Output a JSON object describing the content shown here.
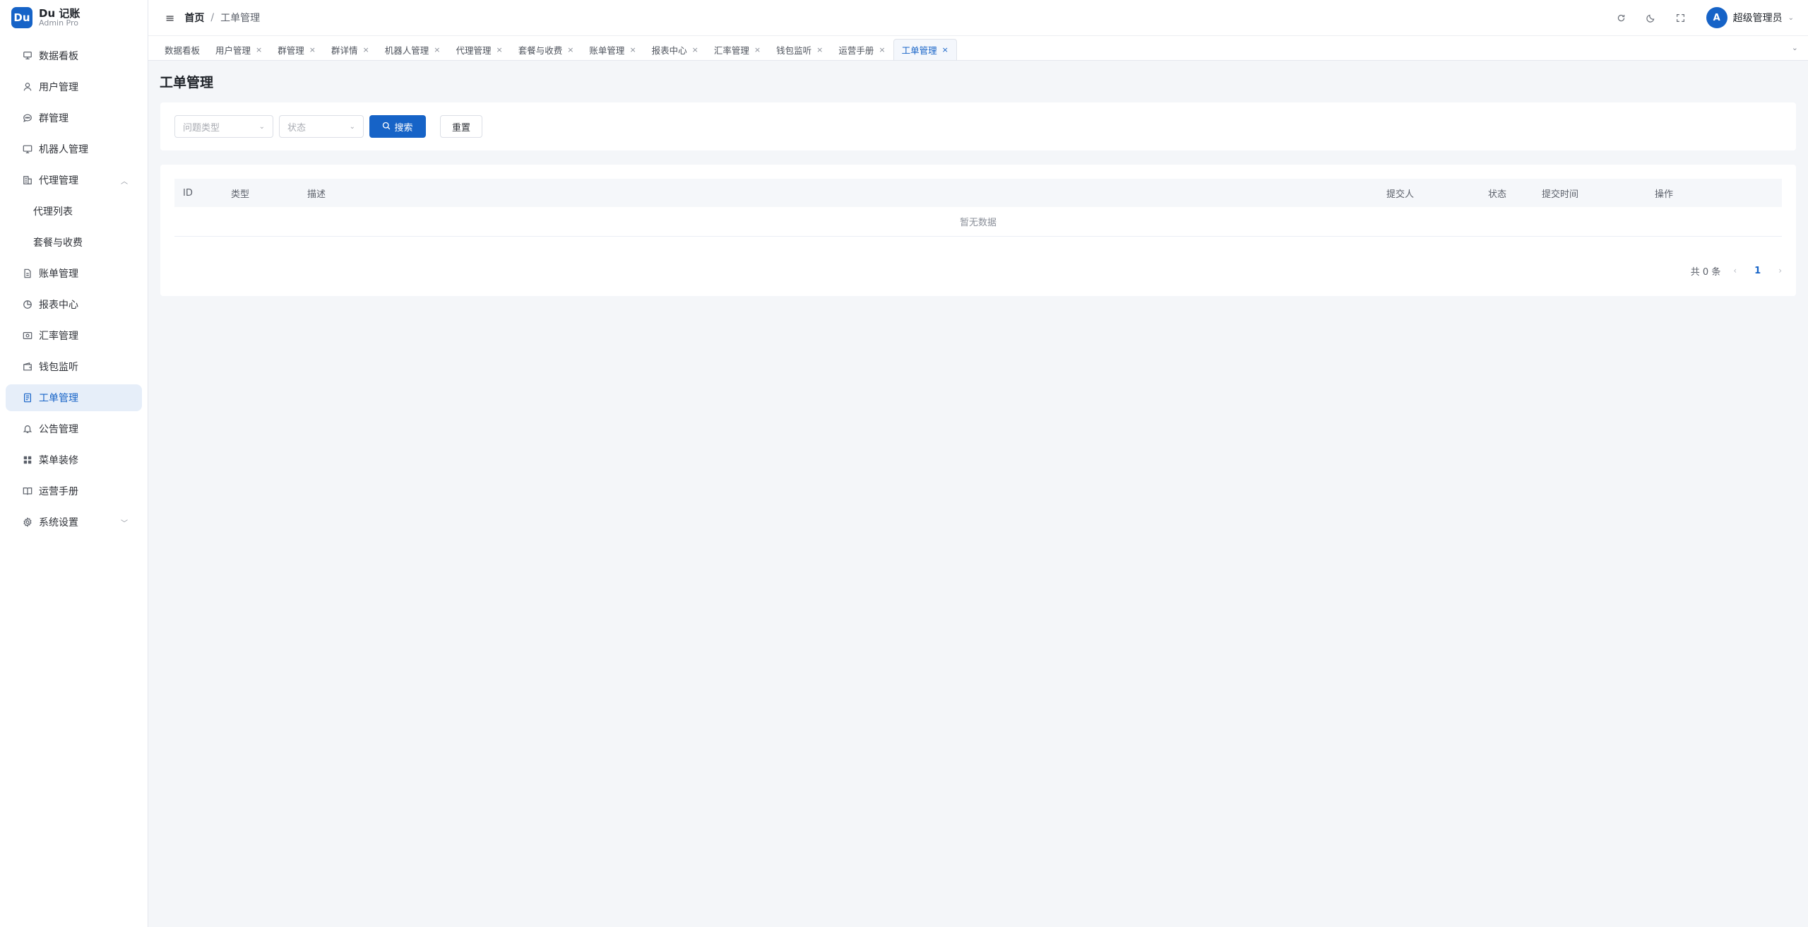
{
  "brand": {
    "logo": "Du",
    "title": "Du 记账",
    "subtitle": "Admin Pro"
  },
  "sidebar": {
    "items": [
      {
        "label": "数据看板",
        "icon": "dashboard-icon"
      },
      {
        "label": "用户管理",
        "icon": "user-icon"
      },
      {
        "label": "群管理",
        "icon": "chat-icon"
      },
      {
        "label": "机器人管理",
        "icon": "monitor-icon"
      },
      {
        "label": "代理管理",
        "icon": "building-icon",
        "expanded": true
      },
      {
        "label": "代理列表",
        "sub": true
      },
      {
        "label": "套餐与收费",
        "sub": true
      },
      {
        "label": "账单管理",
        "icon": "document-icon"
      },
      {
        "label": "报表中心",
        "icon": "pie-chart-icon"
      },
      {
        "label": "汇率管理",
        "icon": "exchange-icon"
      },
      {
        "label": "钱包监听",
        "icon": "wallet-icon"
      },
      {
        "label": "工单管理",
        "icon": "ticket-icon",
        "active": true
      },
      {
        "label": "公告管理",
        "icon": "bell-icon"
      },
      {
        "label": "菜单装修",
        "icon": "grid-icon"
      },
      {
        "label": "运营手册",
        "icon": "book-icon"
      },
      {
        "label": "系统设置",
        "icon": "gear-icon",
        "collapsed": true
      }
    ]
  },
  "header": {
    "breadcrumb_home": "首页",
    "breadcrumb_sep": "/",
    "breadcrumb_current": "工单管理",
    "user_avatar": "A",
    "user_name": "超级管理员"
  },
  "tabs": [
    {
      "label": "数据看板",
      "closable": false
    },
    {
      "label": "用户管理",
      "closable": true
    },
    {
      "label": "群管理",
      "closable": true
    },
    {
      "label": "群详情",
      "closable": true
    },
    {
      "label": "机器人管理",
      "closable": true
    },
    {
      "label": "代理管理",
      "closable": true
    },
    {
      "label": "套餐与收费",
      "closable": true
    },
    {
      "label": "账单管理",
      "closable": true
    },
    {
      "label": "报表中心",
      "closable": true
    },
    {
      "label": "汇率管理",
      "closable": true
    },
    {
      "label": "钱包监听",
      "closable": true
    },
    {
      "label": "运营手册",
      "closable": true
    },
    {
      "label": "工单管理",
      "closable": true,
      "active": true
    }
  ],
  "page": {
    "title": "工单管理",
    "filters": {
      "type_placeholder": "问题类型",
      "status_placeholder": "状态",
      "search_label": "搜索",
      "reset_label": "重置"
    },
    "table": {
      "columns": [
        "ID",
        "类型",
        "描述",
        "提交人",
        "状态",
        "提交时间",
        "操作"
      ],
      "rows": [],
      "empty_text": "暂无数据"
    },
    "pagination": {
      "total_text": "共 0 条",
      "current_page": "1",
      "prev": "‹",
      "next": "›"
    }
  },
  "colors": {
    "primary": "#1663c7",
    "active_bg": "#e6eef9",
    "background": "#f4f6f9"
  }
}
